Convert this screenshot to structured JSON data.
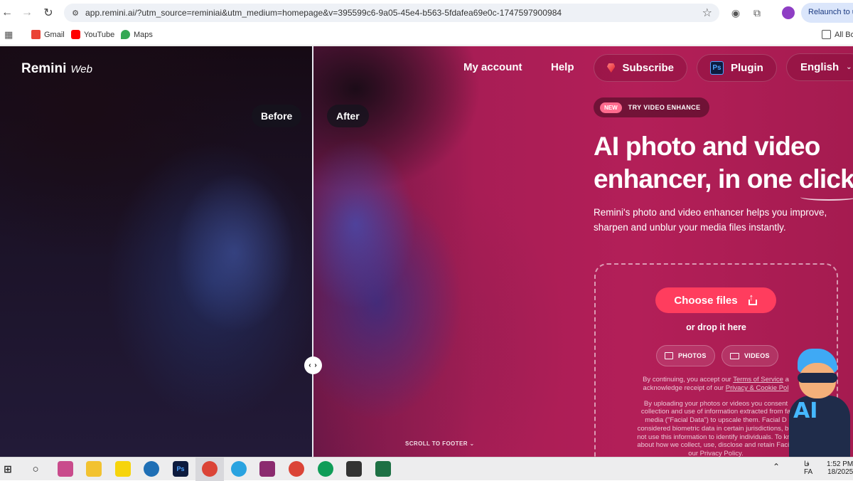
{
  "browser": {
    "url": "app.remini.ai/?utm_source=reminiai&utm_medium=homepage&v=395599c6-9a05-45e4-b563-5fdafea69e0c-1747597900984",
    "relaunch_label": "Relaunch to up",
    "bookmarks": [
      {
        "label": "Gmail",
        "icon": "gmail-icon"
      },
      {
        "label": "YouTube",
        "icon": "youtube-icon"
      },
      {
        "label": "Maps",
        "icon": "maps-icon"
      }
    ],
    "all_bookmarks_label": "All Bo"
  },
  "page": {
    "logo": {
      "brand": "Remini",
      "sub": "Web"
    },
    "nav": {
      "my_account": "My account",
      "help": "Help",
      "subscribe": "Subscribe",
      "plugin": "Plugin",
      "language": "English"
    },
    "compare": {
      "before": "Before",
      "after": "After"
    },
    "hero": {
      "badge_new": "NEW",
      "badge_text": "TRY VIDEO ENHANCE",
      "headline_line1": "AI photo and video",
      "headline_line2": "enhancer, in one click",
      "subcopy": "Remini's photo and video enhancer helps you improve, sharpen and unblur your media files instantly."
    },
    "upload": {
      "choose_files": "Choose files",
      "drop_text": "or drop it here",
      "photos": "PHOTOS",
      "videos": "VIDEOS",
      "legal1_a": "By continuing, you accept our ",
      "legal1_tos": "Terms of Service",
      "legal1_b": " a",
      "legal2_a": "acknowledge receipt of our ",
      "legal2_privacy": "Privacy & Cookie Pol",
      "legal3": "By uploading your photos or videos you consent",
      "legal4": "collection and use of information extracted from fa",
      "legal5": "media (\"Facial Data\") to upscale them. Facial D",
      "legal6": "considered biometric data in certain jurisdictions, but",
      "legal7": "not use this information to identify individuals. To kno",
      "legal8": "about how we collect, use, disclose and retain Facial",
      "legal9": "our Privacy Policy."
    },
    "scroll_footer": "SCROLL TO FOOTER",
    "mascot_text": "AI"
  },
  "taskbar": {
    "time": "1:52 PM",
    "date": "18/2025",
    "lang": "FA",
    "lang_glyph": "فا"
  },
  "colors": {
    "accent": "#ff3d5e",
    "page_bg": "#9e1b4e"
  }
}
